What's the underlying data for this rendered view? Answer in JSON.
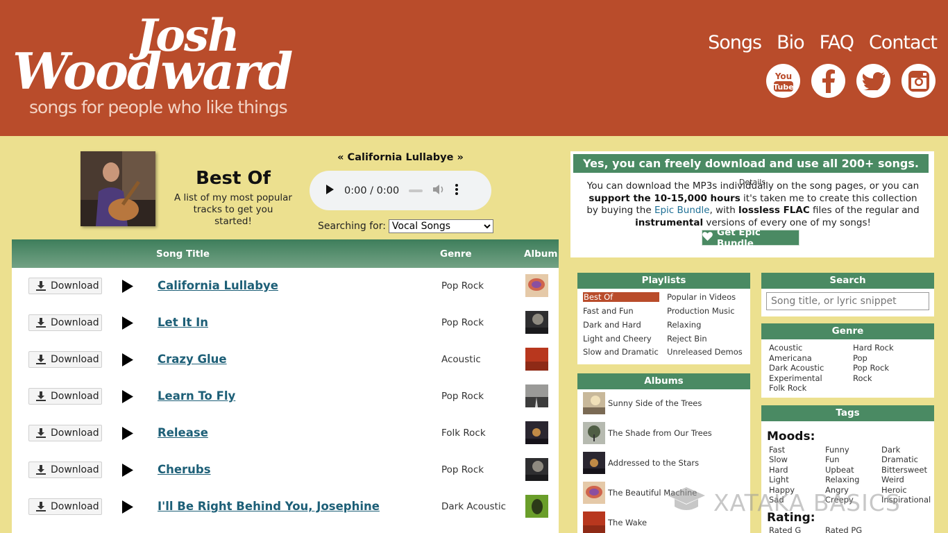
{
  "header": {
    "logo_line1": "Josh",
    "logo_line2": "Woodward",
    "logo_tagline": "songs for people who like things",
    "nav": [
      "Songs",
      "Bio",
      "FAQ",
      "Contact"
    ],
    "social": [
      "youtube-icon",
      "facebook-icon",
      "twitter-icon",
      "instagram-icon"
    ]
  },
  "playlist": {
    "title": "Best Of",
    "subtitle": "A list of my most popular tracks to get you started!",
    "now_playing": "« California Lullabye »",
    "time": "0:00 / 0:00",
    "search_for_label": "Searching for:",
    "search_for_value": "Vocal Songs"
  },
  "table": {
    "headers": {
      "title": "Song Title",
      "genre": "Genre",
      "album": "Album"
    },
    "download_label": "Download",
    "rows": [
      {
        "title": "California Lullabye",
        "genre": "Pop Rock"
      },
      {
        "title": "Let It In",
        "genre": "Pop Rock"
      },
      {
        "title": "Crazy Glue",
        "genre": "Acoustic"
      },
      {
        "title": "Learn To Fly",
        "genre": "Pop Rock"
      },
      {
        "title": "Release",
        "genre": "Folk Rock"
      },
      {
        "title": "Cherubs",
        "genre": "Pop Rock"
      },
      {
        "title": "I'll Be Right Behind You, Josephine",
        "genre": "Dark Acoustic"
      }
    ]
  },
  "download_panel": {
    "heading": "Yes, you can freely download and use all 200+ songs.",
    "details_label": "Details",
    "text_1": "You can download the MP3s individually on the song pages, or you can ",
    "text_support": "support the 10-15,000 hours",
    "text_2": " it's taken me to create this collection by buying the ",
    "text_epic": "Epic Bundle",
    "text_3": ", with ",
    "text_lossless": "lossless FLAC",
    "text_4": " files of the regular and ",
    "text_instr": "instrumental",
    "text_5": " versions of every one of my songs!",
    "button": "Get Epic Bundle"
  },
  "playlists_box": {
    "heading": "Playlists",
    "col1": [
      "Best Of",
      "Fast and Fun",
      "Dark and Hard",
      "Light and Cheery",
      "Slow and Dramatic"
    ],
    "col2": [
      "Popular in Videos",
      "Production Music",
      "Relaxing",
      "Reject Bin",
      "Unreleased Demos"
    ]
  },
  "albums_box": {
    "heading": "Albums",
    "items": [
      "Sunny Side of the Trees",
      "The Shade from Our Trees",
      "Addressed to the Stars",
      "The Beautiful Machine",
      "The Wake"
    ]
  },
  "search_box": {
    "heading": "Search",
    "placeholder": "Song title, or lyric snippet"
  },
  "genre_box": {
    "heading": "Genre",
    "col1": [
      "Acoustic",
      "Americana",
      "Dark Acoustic",
      "Experimental",
      "Folk Rock"
    ],
    "col2": [
      "Hard Rock",
      "Pop",
      "Pop Rock",
      "Rock"
    ]
  },
  "tags_box": {
    "heading": "Tags",
    "moods_label": "Moods:",
    "col1": [
      "Fast",
      "Slow",
      "Hard",
      "Light",
      "Happy",
      "Sad"
    ],
    "col2": [
      "Funny",
      "Fun",
      "Upbeat",
      "Relaxing",
      "Angry",
      "Creepy"
    ],
    "col3": [
      "Dark",
      "Dramatic",
      "Bittersweet",
      "Weird",
      "Heroic",
      "Inspirational"
    ],
    "rating_label": "Rating:",
    "ratings": [
      "Rated G",
      "Rated PG"
    ]
  },
  "watermark": "XATAKA BASICS"
}
